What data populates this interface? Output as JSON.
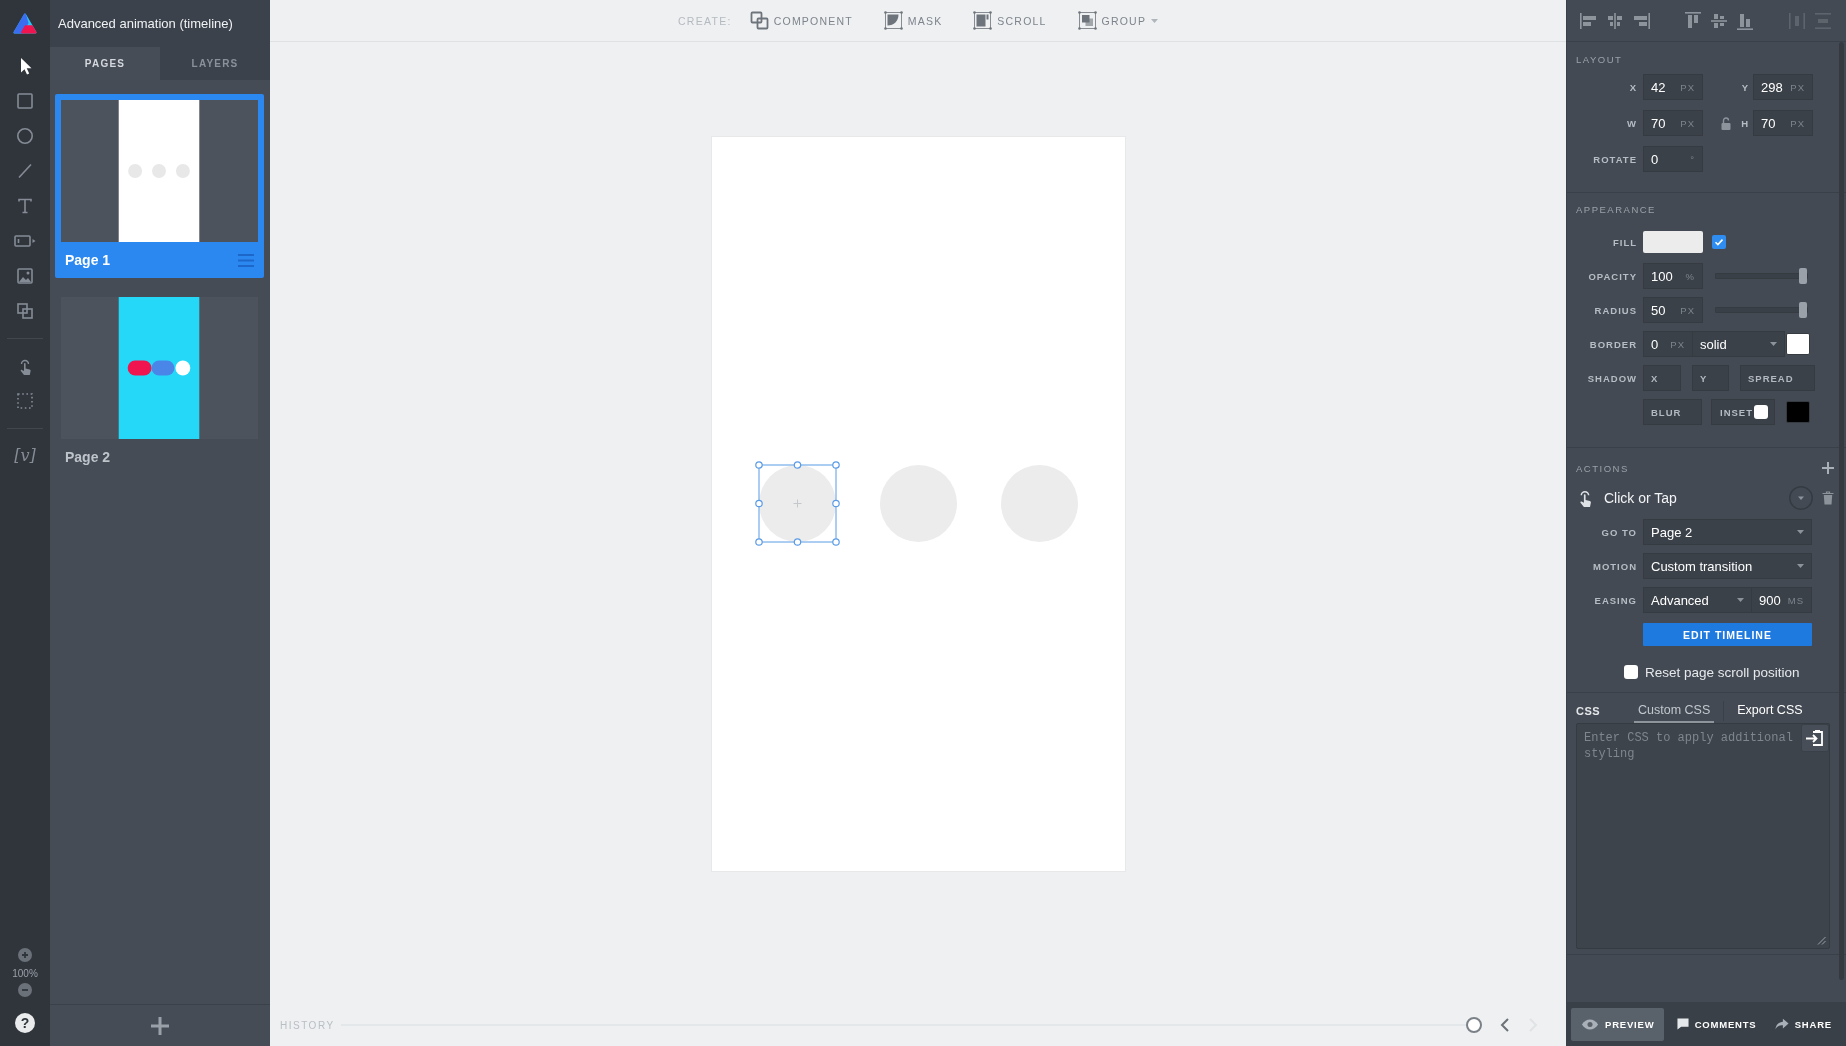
{
  "project": {
    "title": "Advanced animation (timeline)"
  },
  "tool_rail": {
    "tool_groups": [
      {
        "tools": [
          {
            "kind": "pointer",
            "selected": true
          },
          {
            "kind": "rectangle",
            "selected": false
          },
          {
            "kind": "ellipse",
            "selected": false
          },
          {
            "kind": "line",
            "selected": false
          },
          {
            "kind": "text",
            "selected": false
          },
          {
            "kind": "input",
            "selected": false
          },
          {
            "kind": "image",
            "selected": false
          },
          {
            "kind": "component",
            "selected": false
          }
        ]
      },
      {
        "tools": [
          {
            "kind": "hotspot",
            "selected": false
          },
          {
            "kind": "selection",
            "selected": false
          }
        ]
      },
      {
        "tools": [
          {
            "kind": "variables",
            "glyph": "[v]",
            "selected": false
          }
        ]
      }
    ],
    "zoom": {
      "label": "100%"
    },
    "help": {
      "glyph": "?"
    }
  },
  "sidebar": {
    "tabs": [
      {
        "label": "PAGES",
        "selected": true
      },
      {
        "label": "LAYERS",
        "selected": false
      }
    ],
    "pages": [
      {
        "kind": "dots",
        "name": "Page 1",
        "selected": true
      },
      {
        "kind": "pills",
        "name": "Page 2",
        "selected": false
      }
    ]
  },
  "create_toolbar": {
    "label": "CREATE:",
    "items": [
      {
        "kind": "component",
        "label": "COMPONENT",
        "dropdown": false
      },
      {
        "kind": "mask",
        "label": "MASK",
        "dropdown": false
      },
      {
        "kind": "scroll",
        "label": "SCROLL",
        "dropdown": false
      },
      {
        "kind": "group",
        "label": "GROUP",
        "dropdown": true
      }
    ]
  },
  "canvas": {
    "shapes": [
      {
        "selected": true
      },
      {
        "selected": false
      },
      {
        "selected": false
      }
    ]
  },
  "history": {
    "label": "HISTORY",
    "level": 1,
    "nav": [
      {
        "kind": "back",
        "disabled": false
      },
      {
        "kind": "forward",
        "disabled": true
      }
    ]
  },
  "inspector": {
    "distribute": {
      "disabled": true
    },
    "layout": {
      "title": "LAYOUT",
      "x": {
        "label": "X",
        "value": "42",
        "unit": "PX"
      },
      "y": {
        "label": "Y",
        "value": "298",
        "unit": "PX"
      },
      "w": {
        "label": "W",
        "value": "70",
        "unit": "PX"
      },
      "h": {
        "label": "H",
        "value": "70",
        "unit": "PX"
      },
      "aspect_lock": {
        "locked": false
      },
      "rotate": {
        "label": "ROTATE",
        "value": "0",
        "unit": "°"
      }
    },
    "appearance": {
      "title": "APPEARANCE",
      "fill": {
        "label": "FILL",
        "color": "#ececec",
        "enabled": true
      },
      "opacity": {
        "label": "OPACITY",
        "value": "100",
        "unit": "%",
        "level": 1
      },
      "radius": {
        "label": "RADIUS",
        "value": "50",
        "unit": "PX",
        "level": 1
      },
      "border": {
        "label": "BORDER",
        "value": "0",
        "unit": "PX",
        "style": "solid",
        "color": "#ffffff"
      },
      "shadow": {
        "label": "SHADOW",
        "x": {
          "placeholder": "X"
        },
        "y": {
          "placeholder": "Y"
        },
        "spread": {
          "placeholder": "SPREAD"
        },
        "blur": {
          "placeholder": "BLUR"
        },
        "inset": {
          "label": "INSET",
          "checked": false
        },
        "color": "#000000"
      }
    },
    "actions": {
      "title": "ACTIONS",
      "trigger": "Click or Tap",
      "go_to": {
        "label": "GO TO",
        "value": "Page 2"
      },
      "motion": {
        "label": "MOTION",
        "value": "Custom transition"
      },
      "easing": {
        "label": "EASING",
        "value": "Advanced",
        "duration": "900",
        "unit": "MS"
      },
      "edit_button": "EDIT TIMELINE",
      "reset_scroll": {
        "label": "Reset page scroll position",
        "checked": false
      }
    },
    "css": {
      "title": "CSS",
      "tabs": [
        {
          "label": "Custom CSS",
          "selected": true
        },
        {
          "label": "Export CSS",
          "selected": false
        }
      ],
      "placeholder": "Enter CSS to apply additional styling"
    },
    "footer": [
      {
        "kind": "preview",
        "label": "PREVIEW",
        "selected": true
      },
      {
        "kind": "comments",
        "label": "COMMENTS",
        "selected": false
      },
      {
        "kind": "share",
        "label": "SHARE",
        "selected": false
      }
    ]
  }
}
